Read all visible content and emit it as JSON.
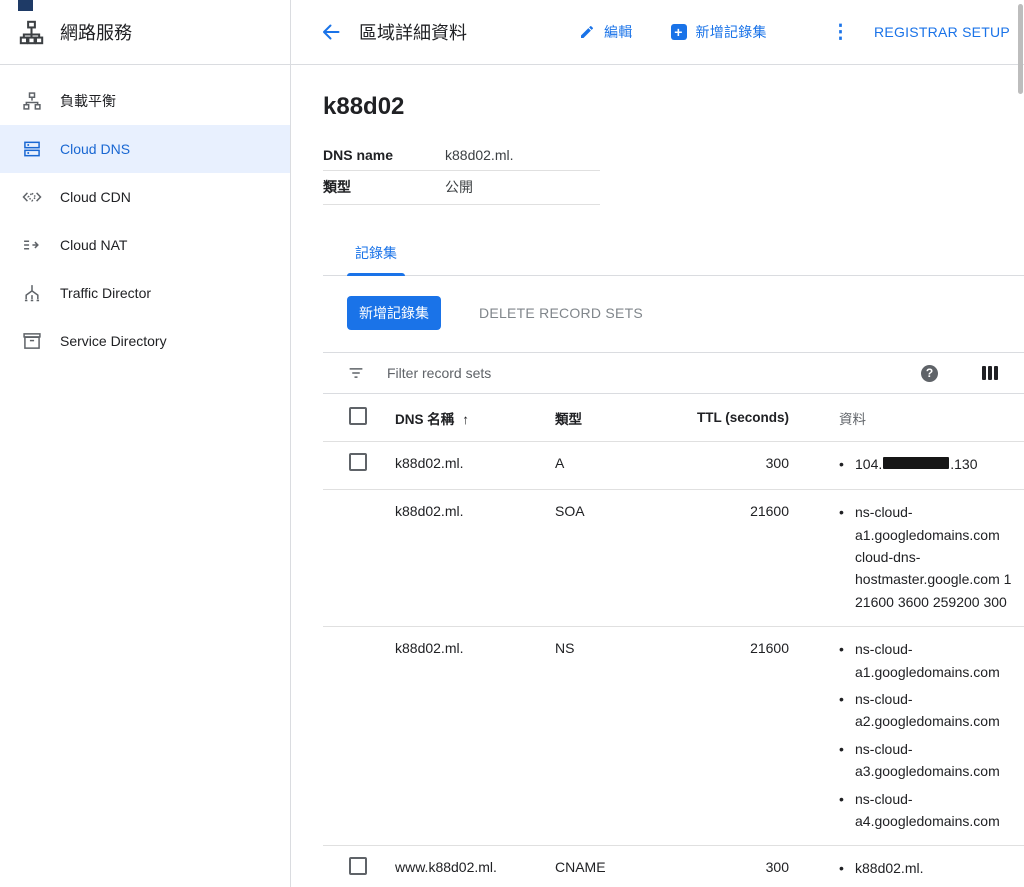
{
  "colors": {
    "accent": "#1a73e8",
    "active_item_bg": "#e8f0fe",
    "active_item_text": "#1967d2",
    "border": "#dadce0",
    "secondary_text": "#5f6368"
  },
  "sidebar": {
    "title": "網路服務",
    "items": [
      {
        "label": "負載平衡",
        "icon": "load-balancing-icon",
        "active": false
      },
      {
        "label": "Cloud DNS",
        "icon": "cloud-dns-icon",
        "active": true
      },
      {
        "label": "Cloud CDN",
        "icon": "cloud-cdn-icon",
        "active": false
      },
      {
        "label": "Cloud NAT",
        "icon": "cloud-nat-icon",
        "active": false
      },
      {
        "label": "Traffic Director",
        "icon": "traffic-director-icon",
        "active": false
      },
      {
        "label": "Service Directory",
        "icon": "service-directory-icon",
        "active": false
      }
    ]
  },
  "header": {
    "title": "區域詳細資料",
    "edit_label": "編輯",
    "add_record_label": "新增記錄集",
    "registrar_label": "REGISTRAR SETUP"
  },
  "zone": {
    "title": "k88d02",
    "details": [
      {
        "label": "DNS name",
        "value": "k88d02.ml."
      },
      {
        "label": "類型",
        "value": "公開"
      }
    ]
  },
  "tab": {
    "record_sets": "記錄集"
  },
  "toolbar": {
    "add_button": "新增記錄集",
    "delete_button": "DELETE RECORD SETS"
  },
  "filter": {
    "placeholder": "Filter record sets"
  },
  "table": {
    "headers": {
      "name": "DNS 名稱",
      "type": "類型",
      "ttl": "TTL (seconds)",
      "data": "資料"
    },
    "rows": [
      {
        "name": "k88d02.ml.",
        "type": "A",
        "ttl": "300",
        "has_checkbox": true,
        "data": [
          {
            "prefix": "104.",
            "suffix": ".130",
            "redacted": true
          }
        ]
      },
      {
        "name": "k88d02.ml.",
        "type": "SOA",
        "ttl": "21600",
        "has_checkbox": false,
        "data": [
          {
            "text": "ns-cloud-a1.googledomains.com cloud-dns-hostmaster.google.com 1 21600 3600 259200 300"
          }
        ]
      },
      {
        "name": "k88d02.ml.",
        "type": "NS",
        "ttl": "21600",
        "has_checkbox": false,
        "data": [
          {
            "text": "ns-cloud-a1.googledomains.com"
          },
          {
            "text": "ns-cloud-a2.googledomains.com"
          },
          {
            "text": "ns-cloud-a3.googledomains.com"
          },
          {
            "text": "ns-cloud-a4.googledomains.com"
          }
        ]
      },
      {
        "name": "www.k88d02.ml.",
        "type": "CNAME",
        "ttl": "300",
        "has_checkbox": true,
        "data": [
          {
            "text": "k88d02.ml."
          }
        ]
      }
    ]
  },
  "icons": {
    "sort_asc": "↑",
    "plus": "+",
    "help": "?",
    "more_vertical": "⋮"
  }
}
